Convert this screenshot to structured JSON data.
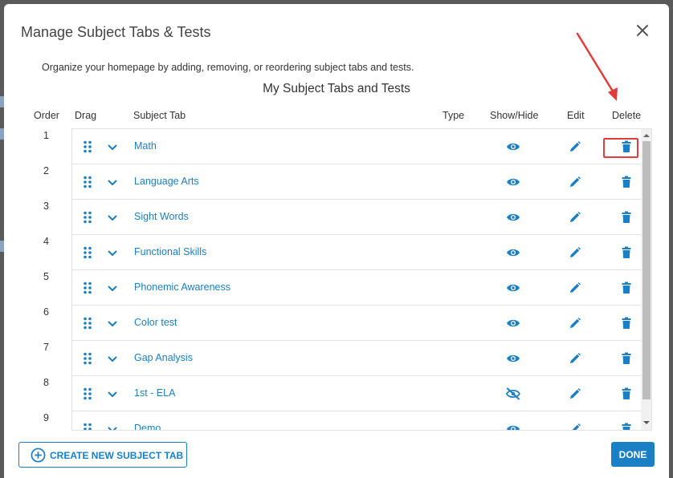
{
  "dialog": {
    "title": "Manage Subject Tabs & Tests",
    "description": "Organize your homepage by adding, removing, or reordering subject tabs and tests.",
    "subtitle": "My Subject Tabs and Tests"
  },
  "columns": {
    "order": "Order",
    "drag": "Drag",
    "subject_tab": "Subject Tab",
    "type": "Type",
    "show_hide": "Show/Hide",
    "edit": "Edit",
    "delete": "Delete"
  },
  "rows": [
    {
      "order": "1",
      "label": "Math",
      "visible": true
    },
    {
      "order": "2",
      "label": "Language Arts",
      "visible": true
    },
    {
      "order": "3",
      "label": "Sight Words",
      "visible": true
    },
    {
      "order": "4",
      "label": "Functional Skills",
      "visible": true
    },
    {
      "order": "5",
      "label": "Phonemic Awareness",
      "visible": true
    },
    {
      "order": "6",
      "label": "Color test",
      "visible": true
    },
    {
      "order": "7",
      "label": "Gap Analysis",
      "visible": true
    },
    {
      "order": "8",
      "label": "1st - ELA",
      "visible": false
    },
    {
      "order": "9",
      "label": "Demo",
      "visible": true
    }
  ],
  "buttons": {
    "create": "CREATE NEW SUBJECT TAB",
    "done": "DONE"
  },
  "icons": {
    "close": "close-icon",
    "drag": "drag-handle-icon",
    "expand": "chevron-down-icon",
    "show": "eye-icon",
    "hide": "eye-off-icon",
    "edit": "pencil-icon",
    "delete": "trash-icon",
    "add": "plus-circle-icon"
  },
  "colors": {
    "accent": "#1a7fc4",
    "annotation": "#e23d3d",
    "text": "#333333"
  }
}
